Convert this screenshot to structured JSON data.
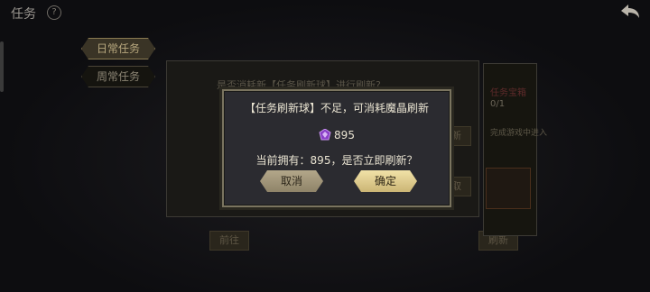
{
  "header": {
    "title": "任务",
    "help_icon": "?"
  },
  "tabs": [
    {
      "label": "日常任务",
      "active": true
    },
    {
      "label": "周常任务",
      "active": false
    }
  ],
  "background": {
    "line": "是否消耗新【任务刷新球】进行刷新?",
    "buttons": [
      "刷新",
      "领取",
      "前往",
      "刷新"
    ],
    "right_card": {
      "title": "任务宝箱",
      "progress": "0/1",
      "hint": "完成游戏中进入"
    }
  },
  "dialog": {
    "message": "【任务刷新球】不足，可消耗魔晶刷新",
    "gem_cost": "895",
    "question": "当前拥有：895，是否立即刷新？",
    "cancel_label": "取消",
    "confirm_label": "确定"
  },
  "icons": {
    "gem": "crystal-gem-icon",
    "back": "back-arrow-icon",
    "chest": "treasure-chest-icon"
  },
  "colors": {
    "confirm": "#eddc9c",
    "cancel": "#a89c7f",
    "dialog_border": "#7a745f"
  }
}
